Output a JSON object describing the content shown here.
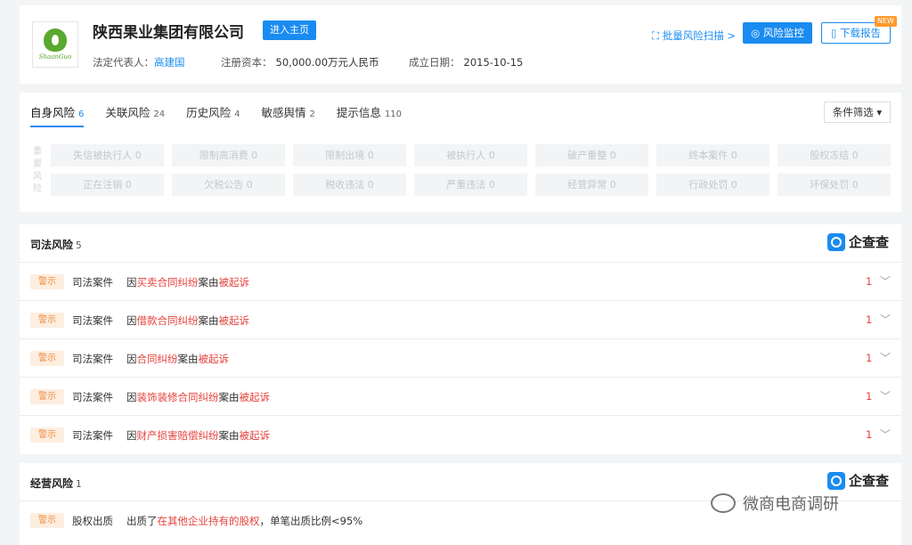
{
  "header": {
    "company_name": "陕西果业集团有限公司",
    "logo_script": "ShaanGuo",
    "enter_home": "进入主页",
    "legal_rep_label": "法定代表人：",
    "legal_rep_value": "高建国",
    "capital_label": "注册资本：",
    "capital_value": "50,000.00万元人民币",
    "established_label": "成立日期：",
    "established_value": "2015-10-15",
    "batch_scan": "批量风险扫描 >",
    "monitor": "风险监控",
    "download": "下载报告",
    "new_badge": "NEW"
  },
  "risk_tabs": {
    "tabs": [
      {
        "label": "自身风险",
        "count": "6"
      },
      {
        "label": "关联风险",
        "count": "24"
      },
      {
        "label": "历史风险",
        "count": "4"
      },
      {
        "label": "敏感舆情",
        "count": "2"
      },
      {
        "label": "提示信息",
        "count": "110"
      }
    ],
    "filter": "条件筛选 ▾",
    "vertical_label": "重要风险",
    "cells": [
      "失信被执行人 0",
      "限制高消费 0",
      "限制出境 0",
      "被执行人 0",
      "破产重整 0",
      "终本案件 0",
      "股权冻结 0",
      "正在注销 0",
      "欠税公告 0",
      "税收违法 0",
      "严重违法 0",
      "经营异常 0",
      "行政处罚 0",
      "环保处罚 0"
    ]
  },
  "judicial": {
    "title": "司法风险",
    "count": "5",
    "brand": "企查查",
    "rows": [
      {
        "badge": "警示",
        "type": "司法案件",
        "p1": "因",
        "hl1": "买卖合同纠纷",
        "p2": "案由",
        "hl2": "被起诉",
        "count": "1"
      },
      {
        "badge": "警示",
        "type": "司法案件",
        "p1": "因",
        "hl1": "借款合同纠纷",
        "p2": "案由",
        "hl2": "被起诉",
        "count": "1"
      },
      {
        "badge": "警示",
        "type": "司法案件",
        "p1": "因",
        "hl1": "合同纠纷",
        "p2": "案由",
        "hl2": "被起诉",
        "count": "1"
      },
      {
        "badge": "警示",
        "type": "司法案件",
        "p1": "因",
        "hl1": "装饰装修合同纠纷",
        "p2": "案由",
        "hl2": "被起诉",
        "count": "1"
      },
      {
        "badge": "警示",
        "type": "司法案件",
        "p1": "因",
        "hl1": "财产损害赔偿纠纷",
        "p2": "案由",
        "hl2": "被起诉",
        "count": "1"
      }
    ]
  },
  "operation": {
    "title": "经营风险",
    "count": "1",
    "brand": "企查查",
    "row": {
      "badge": "警示",
      "type": "股权出质",
      "p1": "出质了",
      "hl1": "在其他企业持有的股权",
      "p2": "，单笔出质比例<95%"
    }
  },
  "watermark": "微商电商调研"
}
